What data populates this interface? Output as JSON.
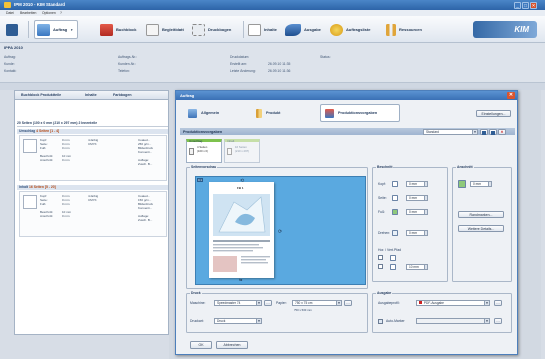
{
  "window": {
    "title": "IPM 2010 - KIM Standard",
    "minimize": "_",
    "maximize": "□",
    "close": "✕"
  },
  "menu": [
    "Datei",
    "Bearbeiten",
    "Optionen",
    "?"
  ],
  "toolbar": {
    "items": [
      {
        "label": "",
        "icon": "save-icon"
      },
      {
        "label": "Auftrag",
        "icon": "order-icon"
      },
      {
        "label": "Buchblock",
        "icon": "book-icon"
      },
      {
        "label": "Begleitblatt",
        "icon": "sheet-icon"
      },
      {
        "label": "Druckbogen",
        "icon": "print-sheet-icon"
      },
      {
        "label": "Inhalte",
        "icon": "content-icon"
      },
      {
        "label": "Ausgabe",
        "icon": "output-icon"
      },
      {
        "label": "Auftragsliste",
        "icon": "list-icon"
      },
      {
        "label": "Ressourcen",
        "icon": "resources-icon"
      }
    ],
    "logo": "KIM"
  },
  "info": {
    "heading": "IPPA 2010",
    "left_labels": [
      "Auftrag:",
      "Kunde:",
      "Kontakt:"
    ],
    "mid_labels": [
      "Auftrags-Nr.:",
      "Kunden-Nr.:",
      "Telefon:"
    ],
    "right_labels": [
      "Druckdatum:",
      "Erstellt am:",
      "Letzte Änderung:"
    ],
    "right_values": [
      "",
      "26.09.10 11:35",
      "26.09.10 11:36"
    ],
    "status_label": "Status:"
  },
  "left_pane": {
    "tabs": [
      "Buchblock Produktteile",
      "Inhalte",
      "Farbbogen"
    ],
    "heading": "20 Seiten  (100 x 0 mm  (210 x 297 mm)  2 Innenteile",
    "sections": [
      {
        "title": "Umschlag",
        "tag": "4 Seiten  [1 - 4]",
        "col1": "Kopf:\nSeite:\nFuß:\n\nBeschnitt:\nAnschnitt:",
        "col2": "0 mm\n0 mm\n0 mm\n\n10 mm\n0 mm",
        "col3": "4-farbig\nCMYK",
        "col4": "Coated...\n250 g/m...\nBilderdruck\nKonventi...\n\nAuflage:\nZusch. B..."
      },
      {
        "title": "Inhalt",
        "tag": "16 Seiten  [5 - 20]",
        "col1": "Kopf:\nSeite:\nFuß:\n\nBeschnitt:\nAnschnitt:",
        "col2": "0 mm\n0 mm\n0 mm\n\n10 mm\n0 mm",
        "col3": "4-farbig\nCMYK",
        "col4": "Coated...\n150 g/m...\nBilderdruck\nKonventi...\n\nAuflage:\nZusch. B..."
      }
    ]
  },
  "dialog": {
    "title": "Auftrag",
    "close": "✕",
    "tabs": [
      "Allgemein",
      "Produkt",
      "Produktionsvorgaben"
    ],
    "settings_button": "Einstellungen...",
    "content_header": "Produktionsvorgaben",
    "preset_value": "Standard",
    "page_tabs": [
      {
        "label": "Umschlag",
        "sub": "4 Seiten\n(100 x 0)"
      },
      {
        "label": "Inhalt",
        "sub": "16 Seiten\n(210 x 297)"
      }
    ],
    "preview_label": "Seitenvorschau",
    "preview_corner": "0.1",
    "page_num": "FB 1",
    "placement": {
      "label": "Beschnitt",
      "rows": [
        {
          "label": "Kopf:",
          "value": "0 mm"
        },
        {
          "label": "Seite:",
          "value": "0 mm"
        },
        {
          "label": "Fuß:",
          "value": "0 mm"
        }
      ],
      "rotation_label": "Drehen:",
      "rotation_value": "0 mm",
      "mirror_label": "Hor. / Vert.Pfad",
      "mirror_value": "10 mm"
    },
    "anschnitt": {
      "label": "Anschnitt",
      "value": "0 mm"
    },
    "side_buttons": [
      "Randmarken...",
      "Weitere Details..."
    ],
    "print": {
      "label": "Druck",
      "machine_label": "Maschine:",
      "machine_value": "Speedmaster 74",
      "paper_label": "Papier:",
      "paper_value": "750 x 75 cm",
      "paper_sub": "750 x 530 mm",
      "print_label": "Druckart:",
      "print_value": "Druck"
    },
    "output": {
      "label": "Ausgabe",
      "profile_label": "Ausgabeprofil:",
      "profile_value": "PDF-Ausgabe",
      "checkbox_label": "Auto-Marker"
    },
    "ok": "OK",
    "cancel": "Abbrechen"
  }
}
